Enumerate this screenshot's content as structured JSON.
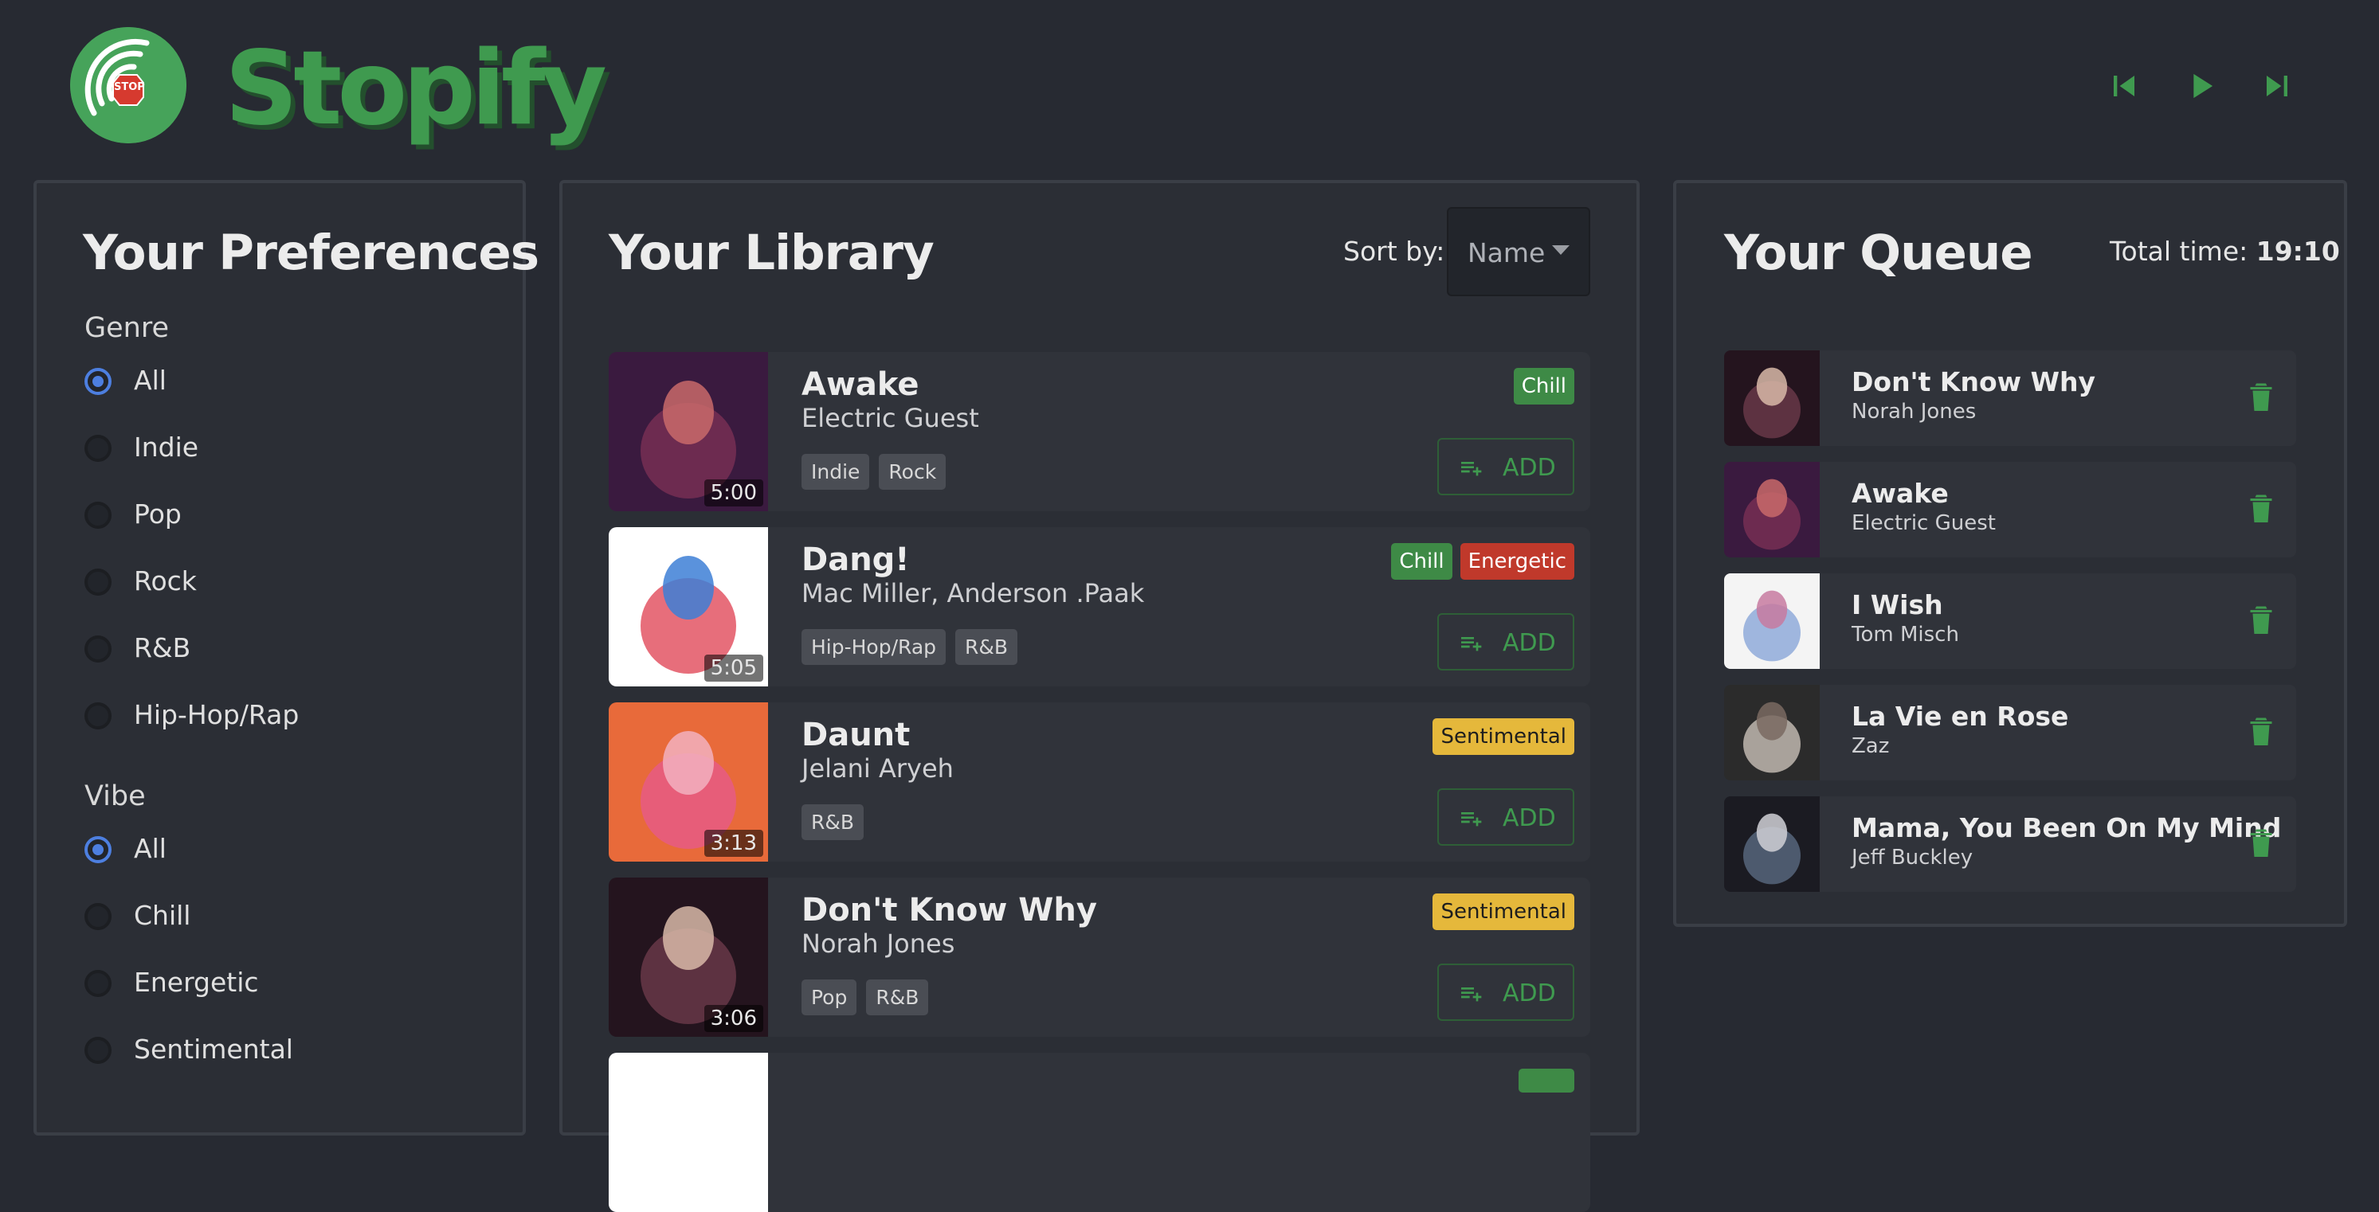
{
  "app": {
    "brand": "Stopify",
    "logo_text": "STOP"
  },
  "colors": {
    "accent": "#3f9a4f",
    "background": "#272a32",
    "panel": "#2b2e35",
    "card": "#30333a",
    "radio_selected": "#4d7fe0",
    "chill": "#3e8a46",
    "energetic": "#c0392b",
    "sentimental": "#e5b83b"
  },
  "player": {
    "prev_icon": "skip-previous-icon",
    "play_icon": "play-icon",
    "next_icon": "skip-next-icon"
  },
  "preferences": {
    "title": "Your Preferences",
    "genre": {
      "title": "Genre",
      "options": [
        "All",
        "Indie",
        "Pop",
        "Rock",
        "R&B",
        "Hip-Hop/Rap"
      ],
      "selected": "All"
    },
    "vibe": {
      "title": "Vibe",
      "options": [
        "All",
        "Chill",
        "Energetic",
        "Sentimental"
      ],
      "selected": "All"
    }
  },
  "library": {
    "title": "Your Library",
    "sort_label": "Sort by:",
    "sort_value": "Name",
    "add_label": "ADD",
    "songs": [
      {
        "title": "Awake",
        "artist": "Electric Guest",
        "duration": "5:00",
        "genres": [
          "Indie",
          "Rock"
        ],
        "vibes": [
          "Chill"
        ]
      },
      {
        "title": "Dang!",
        "artist": "Mac Miller, Anderson .Paak",
        "duration": "5:05",
        "genres": [
          "Hip-Hop/Rap",
          "R&B"
        ],
        "vibes": [
          "Chill",
          "Energetic"
        ]
      },
      {
        "title": "Daunt",
        "artist": "Jelani Aryeh",
        "duration": "3:13",
        "genres": [
          "R&B"
        ],
        "vibes": [
          "Sentimental"
        ]
      },
      {
        "title": "Don't Know Why",
        "artist": "Norah Jones",
        "duration": "3:06",
        "genres": [
          "Pop",
          "R&B"
        ],
        "vibes": [
          "Sentimental"
        ]
      }
    ]
  },
  "queue": {
    "title": "Your Queue",
    "total_label": "Total time:",
    "total_value": "19:10",
    "items": [
      {
        "title": "Don't Know Why",
        "artist": "Norah Jones"
      },
      {
        "title": "Awake",
        "artist": "Electric Guest"
      },
      {
        "title": "I Wish",
        "artist": "Tom Misch"
      },
      {
        "title": "La Vie en Rose",
        "artist": "Zaz"
      },
      {
        "title": "Mama, You Been On My Mind",
        "artist": "Jeff Buckley"
      }
    ]
  }
}
